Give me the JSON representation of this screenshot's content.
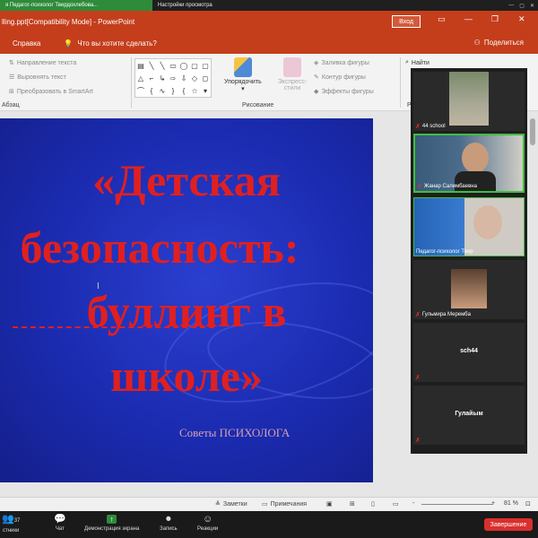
{
  "zoom_top": {
    "share_label": "я Педагог-психолог Твердохлебова...",
    "view_options": "Настройки просмотра"
  },
  "window": {
    "title": "lling.ppt[Compatibility Mode]  -  PowerPoint",
    "login": "Вход",
    "minimize": "—",
    "restore": "❐",
    "close": "✕"
  },
  "ribbon_tabs": {
    "help": "Справка",
    "tell_me": "Что вы хотите сделать?",
    "share": "Поделиться"
  },
  "ribbon": {
    "text_direction": "Направление текста",
    "align_text": "Выровнять текст",
    "smartart": "Преобразовать в SmartArt",
    "paragraph_group": "Абзац",
    "arrange": "Упорядочить",
    "quick_styles": "Экспресс-стили",
    "shape_fill": "Заливка фигуры",
    "shape_outline": "Контур фигуры",
    "shape_effects": "Эффекты фигуры",
    "drawing_group": "Рисование",
    "find": "Найти",
    "editing_group": "Ре"
  },
  "slide": {
    "line1": "«Детская",
    "line2": "безопасность:",
    "line3": "буллинг в",
    "line4": "школе»",
    "subtitle": "Советы ПСИХОЛОГА"
  },
  "participants": [
    {
      "name": "44 school",
      "type": "video"
    },
    {
      "name": "Жанар Салимбаевна",
      "type": "video"
    },
    {
      "name": "Педагог-психолог Твер",
      "type": "video"
    },
    {
      "name": "Гульмира Мерембa",
      "type": "photo"
    },
    {
      "name": "sch44",
      "type": "name-only"
    },
    {
      "name": "Гулайым",
      "type": "name-only"
    }
  ],
  "status_bar": {
    "notes": "Заметки",
    "comments": "Примечания",
    "zoom_level": "81 %",
    "zoom_minus": "-",
    "zoom_plus": "+"
  },
  "zoom_bottom": {
    "participants_count": "37",
    "participants_label": "стники",
    "chat": "Чат",
    "share_screen": "Демонстрация экрана",
    "record": "Запись",
    "reactions": "Реакции",
    "end": "Завершение"
  },
  "colors": {
    "powerpoint_red": "#c43e1c",
    "zoom_green": "#2e8b3a",
    "end_red": "#d9302c",
    "slide_text_red": "#e02020"
  }
}
